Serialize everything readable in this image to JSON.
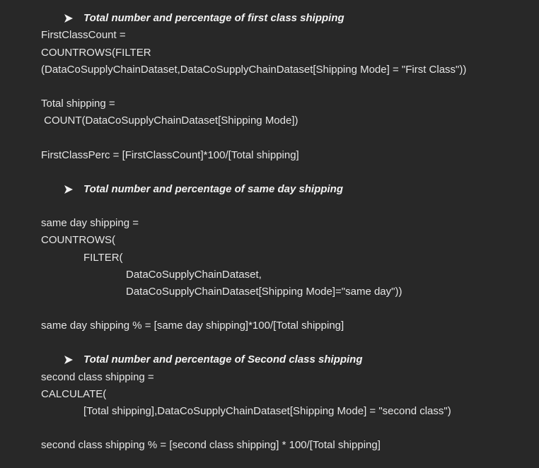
{
  "colors": {
    "background": "#282828",
    "text": "#e6e6e6",
    "heading": "#f2f2f2"
  },
  "sections": [
    {
      "bullet_icon": "arrow-bullet-icon",
      "heading": "Total number and percentage of first class shipping",
      "lines": [
        "FirstClassCount =",
        "COUNTROWS(FILTER",
        "(DataCoSupplyChainDataset,DataCoSupplyChainDataset[Shipping Mode] = \"First Class\"))",
        "Total shipping =",
        " COUNT(DataCoSupplyChainDataset[Shipping Mode])",
        "FirstClassPerc = [FirstClassCount]*100/[Total shipping]"
      ]
    },
    {
      "bullet_icon": "arrow-bullet-icon",
      "heading": "Total number and percentage of same day shipping",
      "lines": [
        "same day shipping =",
        "COUNTROWS(",
        "FILTER(",
        "DataCoSupplyChainDataset,",
        "DataCoSupplyChainDataset[Shipping Mode]=\"same day\"))",
        "same day shipping % = [same day shipping]*100/[Total shipping]"
      ]
    },
    {
      "bullet_icon": "arrow-bullet-icon",
      "heading": "Total number and percentage of Second class shipping",
      "lines": [
        "second class shipping =",
        "CALCULATE(",
        "[Total shipping],DataCoSupplyChainDataset[Shipping Mode] = \"second class\")",
        "second class shipping % = [second class shipping] * 100/[Total shipping]"
      ]
    }
  ]
}
